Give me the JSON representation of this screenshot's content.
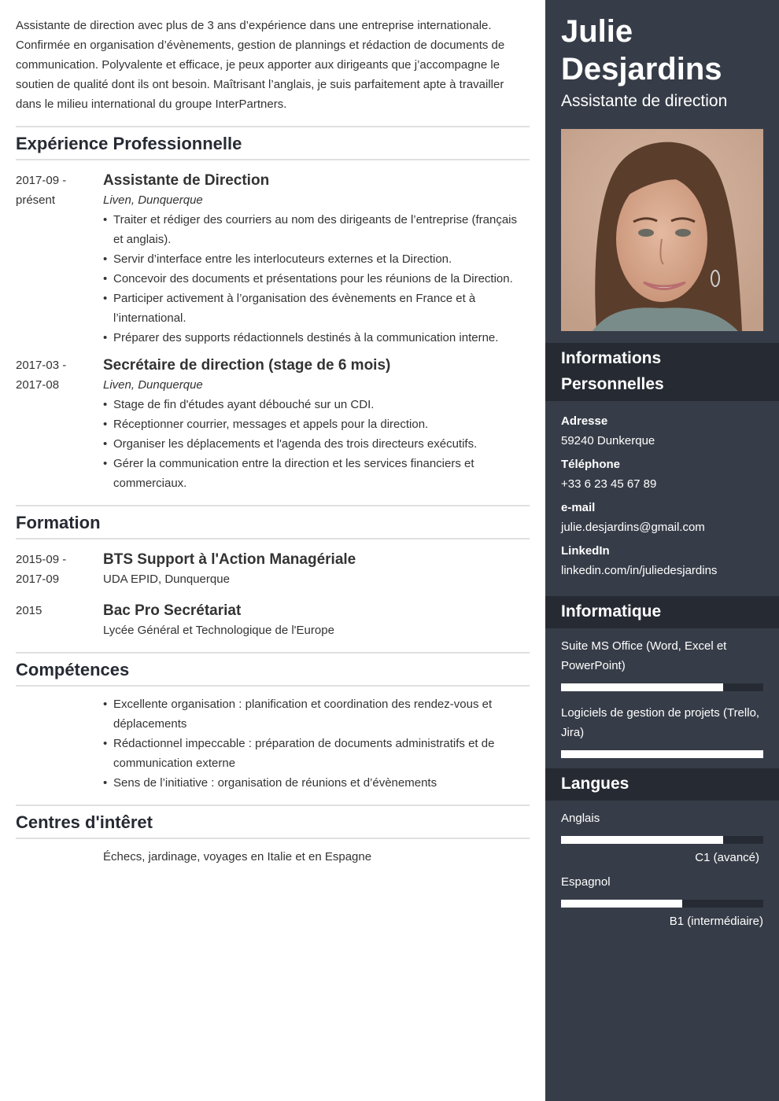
{
  "summary": "Assistante de direction avec plus de 3 ans d’expérience dans une entreprise internationale. Confirmée en organisation d’évènements, gestion de plannings et rédaction de documents de communication. Polyvalente et efficace, je peux apporter aux dirigeants que j’accompagne le soutien de qualité dont ils ont besoin. Maîtrisant l’anglais, je suis parfaitement apte à travailler dans le milieu international du groupe InterPartners.",
  "experience": {
    "title": "Expérience Professionnelle",
    "items": [
      {
        "date_start": "2017-09 -",
        "date_end": "présent",
        "title": "Assistante de Direction",
        "company": "Liven, Dunquerque",
        "bullets": [
          "Traiter et rédiger des courriers au nom des dirigeants de l’entreprise (français et anglais).",
          "Servir d’interface entre les interlocuteurs externes et la Direction.",
          "Concevoir des documents et présentations pour les réunions de la Direction.",
          "Participer activement à l’organisation des évènements en France et à l’international.",
          "Préparer des supports rédactionnels destinés à la communication interne."
        ]
      },
      {
        "date_start": "2017-03 -",
        "date_end": "2017-08",
        "title": "Secrétaire de direction (stage de 6 mois)",
        "company": "Liven, Dunquerque",
        "bullets": [
          "Stage de fin d'études ayant débouché sur un CDI.",
          "Réceptionner courrier, messages et appels pour la direction.",
          "Organiser les déplacements et l'agenda des trois directeurs exécutifs.",
          "Gérer la communication entre la direction et les services financiers et commerciaux."
        ]
      }
    ]
  },
  "education": {
    "title": "Formation",
    "items": [
      {
        "date_start": "2015-09 -",
        "date_end": "2017-09",
        "title": "BTS Support à l'Action Managériale",
        "school": "UDA EPID, Dunquerque"
      },
      {
        "date_start": "2015",
        "date_end": "",
        "title": "Bac Pro Secrétariat",
        "school": "Lycée Général et Technologique de l'Europe"
      }
    ]
  },
  "skills": {
    "title": "Compétences",
    "items": [
      "Excellente organisation : planification et coordination des rendez-vous et déplacements",
      "Rédactionnel impeccable : préparation de documents administratifs et de communication externe",
      "Sens de l’initiative : organisation de réunions et d’évènements"
    ]
  },
  "interests": {
    "title": "Centres d'intêret",
    "text": "Échecs, jardinage, voyages en Italie et en Espagne"
  },
  "sidebar": {
    "first_name": "Julie",
    "last_name": "Desjardins",
    "role": "Assistante de direction",
    "personal": {
      "title_line1": "Informations",
      "title_line2": "Personnelles",
      "fields": [
        {
          "label": "Adresse",
          "value": "59240 Dunkerque"
        },
        {
          "label": "Téléphone",
          "value": "+33 6 23 45 67 89"
        },
        {
          "label": "e-mail",
          "value": "julie.desjardins@gmail.com"
        },
        {
          "label": "LinkedIn",
          "value": "linkedin.com/in/juliedesjardins"
        }
      ]
    },
    "it": {
      "title": "Informatique",
      "items": [
        {
          "name": "Suite MS Office (Word, Excel et PowerPoint)",
          "level": 0.8
        },
        {
          "name": "Logiciels de gestion de projets (Trello, Jira)",
          "level": 1.0
        }
      ]
    },
    "languages": {
      "title": "Langues",
      "items": [
        {
          "name": "Anglais",
          "level": 0.8,
          "label": "C1 (avancé)"
        },
        {
          "name": "Espagnol",
          "level": 0.6,
          "label": "B1 (intermédiaire)"
        }
      ]
    }
  },
  "colors": {
    "sidebar_bg": "#373d48",
    "sidebar_header_bg": "#262a32",
    "heading_text": "#262a33",
    "body_text": "#333333"
  }
}
